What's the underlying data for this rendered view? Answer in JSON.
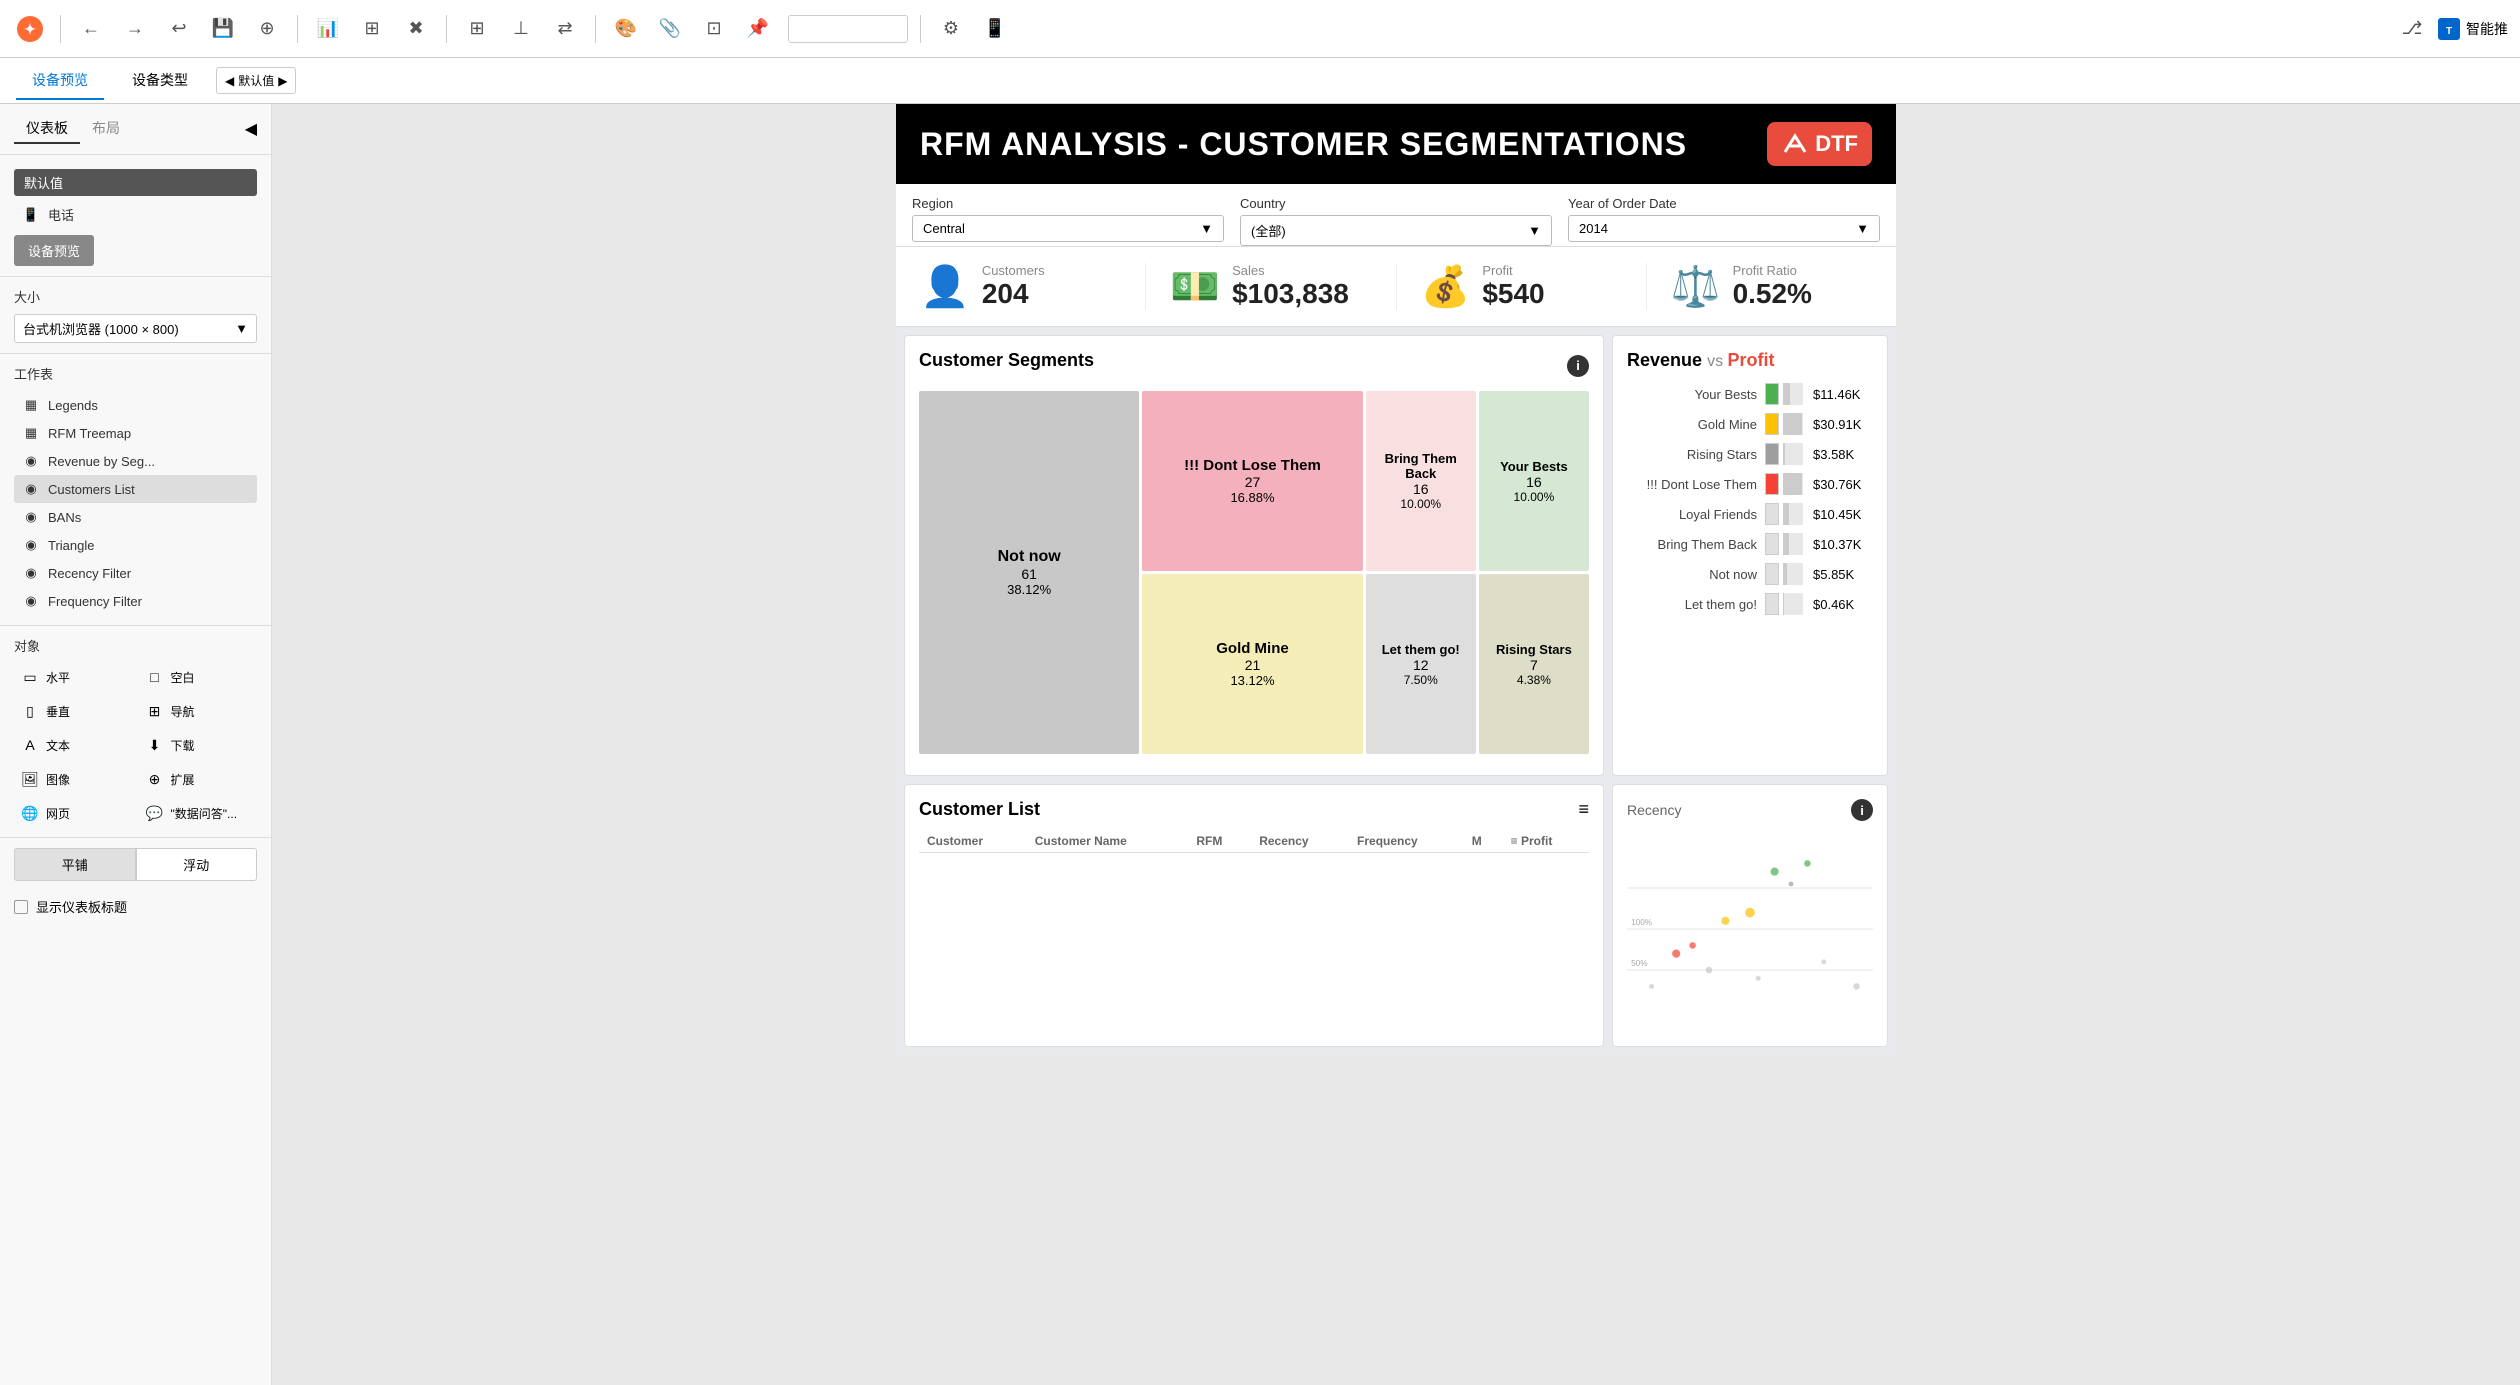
{
  "toolbar": {
    "back_label": "←",
    "forward_label": "→",
    "undo_label": "↩",
    "title_label": "智能推",
    "logo_label": "✦",
    "share_label": "⎇"
  },
  "subtoolbar": {
    "device_preview": "设备预览",
    "device_type": "设备类型",
    "default_label": "默认值",
    "arrow_left": "◀",
    "arrow_right": "▶"
  },
  "sidebar": {
    "tab1": "仪表板",
    "tab2": "布局",
    "collapse_icon": "◀",
    "selected_view": "默认值",
    "phone_option": "电话",
    "preview_btn": "设备预览",
    "size_label": "大小",
    "size_value": "台式机浏览器 (1000 × 800)",
    "worktable_label": "工作表",
    "items": [
      {
        "id": "legends",
        "label": "Legends",
        "icon": "▦"
      },
      {
        "id": "rfm-treemap",
        "label": "RFM Treemap",
        "icon": "▦"
      },
      {
        "id": "revenue-by-seg",
        "label": "Revenue by Seg...",
        "icon": "◉"
      },
      {
        "id": "customers-list",
        "label": "Customers List",
        "icon": "◉"
      },
      {
        "id": "bans",
        "label": "BANs",
        "icon": "◉"
      },
      {
        "id": "triangle",
        "label": "Triangle",
        "icon": "◉"
      },
      {
        "id": "recency-filter",
        "label": "Recency Filter",
        "icon": "◉"
      },
      {
        "id": "frequency-filter",
        "label": "Frequency Filter",
        "icon": "◉"
      }
    ],
    "objects_label": "对象",
    "objects": [
      {
        "id": "horizontal",
        "label": "水平",
        "icon": "▭"
      },
      {
        "id": "blank",
        "label": "空白",
        "icon": "□"
      },
      {
        "id": "vertical",
        "label": "垂直",
        "icon": "▯"
      },
      {
        "id": "navigation",
        "label": "导航",
        "icon": "⊞"
      },
      {
        "id": "text",
        "label": "文本",
        "icon": "A"
      },
      {
        "id": "download",
        "label": "下载",
        "icon": "⬇"
      },
      {
        "id": "image",
        "label": "图像",
        "icon": "🖼"
      },
      {
        "id": "expand",
        "label": "扩展",
        "icon": "⊕"
      },
      {
        "id": "web",
        "label": "网页",
        "icon": "🌐"
      },
      {
        "id": "ask-data",
        "label": "\"数据问答\"...",
        "icon": "💬"
      }
    ],
    "flat_label": "平铺",
    "float_label": "浮动",
    "show_title": "显示仪表板标题"
  },
  "dashboard": {
    "title": "RFM ANALYSIS - CUSTOMER SEGMENTATIONS",
    "badge": "DTF",
    "filters": {
      "region_label": "Region",
      "region_value": "Central",
      "country_label": "Country",
      "country_value": "(全部)",
      "year_label": "Year of Order Date",
      "year_value": "2014"
    },
    "kpis": {
      "customers_label": "Customers",
      "customers_value": "204",
      "sales_label": "Sales",
      "sales_value": "$103,838",
      "profit_label": "Profit",
      "profit_value": "$540",
      "profit_ratio_label": "Profit Ratio",
      "profit_ratio_value": "0.52%"
    },
    "treemap": {
      "title": "Customer Segments",
      "cells": [
        {
          "name": "Not now",
          "count": "61",
          "pct": "38.12%",
          "bg": "#d0d0d0",
          "span_col": 1,
          "span_row": 2
        },
        {
          "name": "!!! Dont Lose Them",
          "count": "27",
          "pct": "16.88%",
          "bg": "#f4b8c0",
          "span_col": 1,
          "span_row": 1
        },
        {
          "name": "Bring Them Back",
          "count": "16",
          "pct": "10.00%",
          "bg": "#f8e0e0",
          "span_col": 1,
          "span_row": 1
        },
        {
          "name": "Your Bests",
          "count": "16",
          "pct": "10.00%",
          "bg": "#d5e8d4",
          "span_col": 1,
          "span_row": 1
        },
        {
          "name": "Gold Mine",
          "count": "21",
          "pct": "13.12%",
          "bg": "#f9f0c0",
          "span_col": 1,
          "span_row": 1
        },
        {
          "name": "Let them go!",
          "count": "12",
          "pct": "7.50%",
          "bg": "#e0e0e0",
          "span_col": 1,
          "span_row": 1
        },
        {
          "name": "Rising Stars",
          "count": "7",
          "pct": "4.38%",
          "bg": "#e0e0d0",
          "span_col": 1,
          "span_row": 1
        }
      ]
    },
    "revprofit": {
      "title_revenue": "Revenue",
      "title_vs": "vs",
      "title_profit": "Profit",
      "bars": [
        {
          "label": "Your Bests",
          "color": "#4caf50",
          "value": "$11.46K",
          "width_pct": 35
        },
        {
          "label": "Gold Mine",
          "color": "#ffc107",
          "value": "$30.91K",
          "width_pct": 95
        },
        {
          "label": "Rising Stars",
          "color": "#9e9e9e",
          "value": "$3.58K",
          "width_pct": 11
        },
        {
          "label": "!!! Dont Lose Them",
          "color": "#f44336",
          "value": "$30.76K",
          "width_pct": 94
        },
        {
          "label": "Loyal Friends",
          "color": "#e0e0e0",
          "value": "$10.45K",
          "width_pct": 32
        },
        {
          "label": "Bring Them Back",
          "color": "#e0e0e0",
          "value": "$10.37K",
          "width_pct": 32
        },
        {
          "label": "Not now",
          "color": "#e0e0e0",
          "value": "$5.85K",
          "width_pct": 18
        },
        {
          "label": "Let them go!",
          "color": "#e0e0e0",
          "value": "$0.46K",
          "width_pct": 2
        }
      ]
    },
    "customer_list": {
      "title": "Customer List",
      "columns": [
        "Customer",
        "Customer Name",
        "RFM",
        "Recency",
        "Frequency",
        "M",
        "Profit"
      ],
      "note": "≡"
    },
    "scatter_note": "ℹ"
  }
}
